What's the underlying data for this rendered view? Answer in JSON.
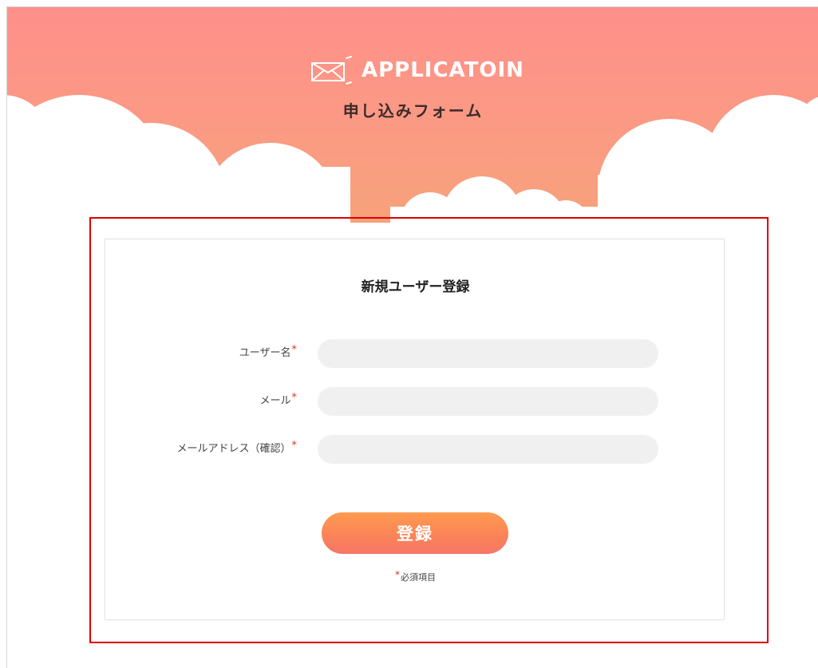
{
  "header": {
    "logo_text": "APPLICATOIN",
    "subtitle": "申し込みフォーム",
    "gradient_top": "#ff8f8b",
    "gradient_bottom": "#f7a27a"
  },
  "form": {
    "title": "新規ユーザー登録",
    "required_mark": "*",
    "fields": [
      {
        "label": "ユーザー名",
        "value": "",
        "placeholder": ""
      },
      {
        "label": "メール",
        "value": "",
        "placeholder": ""
      },
      {
        "label": "メールアドレス（確認）",
        "value": "",
        "placeholder": ""
      }
    ],
    "submit_label": "登録",
    "required_note": "必須項目"
  },
  "icons": {
    "logo_icon": "envelope-outline-icon"
  },
  "colors": {
    "highlight_border": "#e00000",
    "required_mark": "#d7352c",
    "button_gradient_start": "#ff9b50",
    "button_gradient_end": "#f77566",
    "input_background": "#f0f0f0"
  }
}
